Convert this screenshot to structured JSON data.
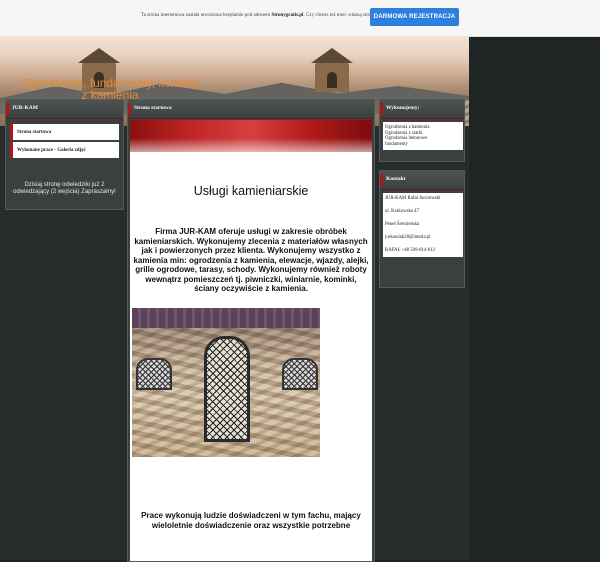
{
  "topbar": {
    "notice_prefix": "Ta strona internetowa została utworzona bezpłatnie pod adresem",
    "notice_site": "Stronygratis.pl",
    "notice_suffix": ". Czy chcesz też mieć własną stronę?",
    "register_button": "DARMOWA REJESTRACJA",
    "button_color": "#2d7fe0"
  },
  "header": {
    "site_title": "Ogrodzenia, fundamenty, kominki z kamienia"
  },
  "left": {
    "box_title": "JUR-KAM",
    "menu": [
      {
        "label": "Strona startowa"
      },
      {
        "label": "Wykonane prace - Galeria zdjęć"
      }
    ],
    "visitors_note": "Dzisiaj stronę odwiedziło już 2 odwiedzający (2 wejścia) Zapraszamy!"
  },
  "center": {
    "box_title": "Strona startowa",
    "heading": "Usługi kamieniarskie",
    "paragraph": "Firma JUR-KAM oferuje usługi w zakresie obróbek kamieniarskich. Wykonujemy zlecenia z materiałów własnych  jak i powierzonych przez klienta. Wykonujemy wszystko z kamienia min: ogrodzenia z kamienia, elewacje, wjazdy, alejki, grille ogrodowe, tarasy, schody. Wykonujemy również roboty wewnątrz pomieszczeń tj. piwniczki, winiarnie, kominki, ściany oczywiście z kamienia.",
    "paragraph2": "Prace wykonują ludzie doświadczeni w tym fachu, mający wieloletnie doświadczenie oraz wszystkie potrzebne"
  },
  "right": {
    "services_title": "Wykonujemy:",
    "services": [
      "Ogrodzenia z kamienia",
      "Ogrodzenia z siatki",
      "Ogrodzenia betonowe",
      "fundamenty"
    ],
    "contact_title": "Kontakt",
    "contact_company": "JUR-KAM Rafał Jurczewski",
    "contact_street": "ul. Krakowska 47",
    "contact_city": "Peneł Śremieńska",
    "contact_email": "jurkawiak28@interia.pl",
    "contact_phone": "RAFAŁ +48 509-814-612"
  },
  "colors": {
    "accent_red": "#b01818",
    "title_orange": "#e58a30",
    "page_bg": "#1f2424"
  }
}
